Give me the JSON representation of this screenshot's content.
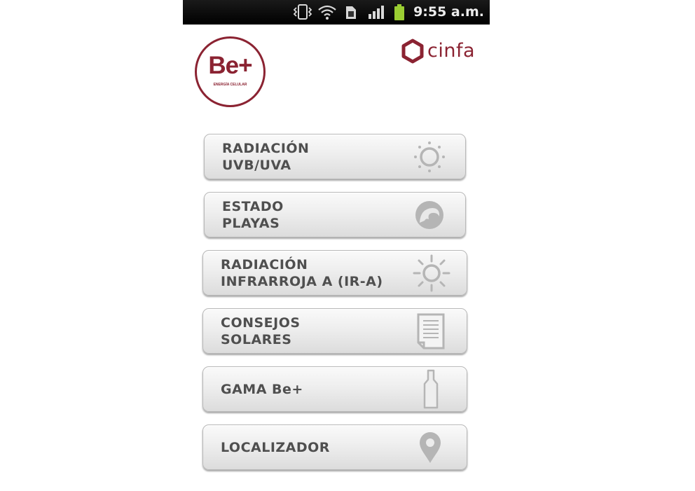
{
  "status_bar": {
    "time": "9:55 a.m.",
    "icons": [
      "vibrate-icon",
      "wifi-icon",
      "sim-card-icon",
      "signal-icon",
      "battery-icon"
    ]
  },
  "header": {
    "brand_logo": {
      "text": "Be+",
      "subtitle": "ENERGÍA CELULAR"
    },
    "company_logo": {
      "text": "cinfa"
    }
  },
  "colors": {
    "brand": "#8b2332",
    "button_text": "#4f4f4f",
    "icon_gray": "#b5b5b5",
    "status_bar": "#000000"
  },
  "menu": {
    "items": [
      {
        "label": "RADIACIÓN\nUVB/UVA",
        "icon": "sun-dotted-icon"
      },
      {
        "label": "ESTADO\nPLAYAS",
        "icon": "wave-icon"
      },
      {
        "label": "RADIACIÓN\nINFRARROJA A (IR-A)",
        "icon": "sun-rays-icon"
      },
      {
        "label": "CONSEJOS\nSOLARES",
        "icon": "document-icon"
      },
      {
        "label": "GAMA Be+",
        "icon": "bottle-icon"
      },
      {
        "label": "LOCALIZADOR",
        "icon": "location-pin-icon"
      }
    ]
  }
}
